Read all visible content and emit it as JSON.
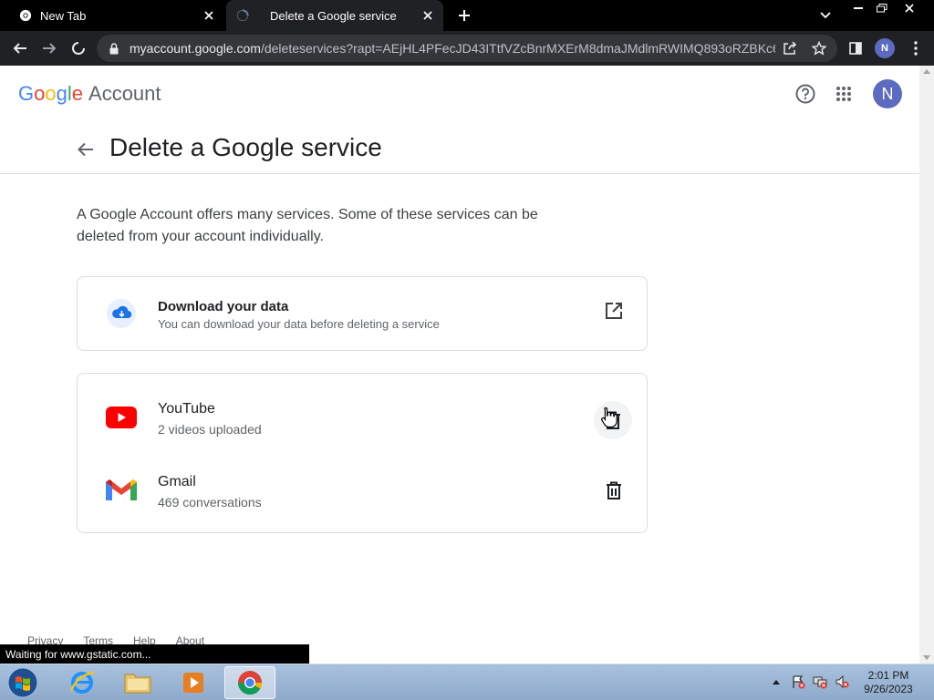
{
  "browser": {
    "tabs": [
      {
        "title": "New Tab",
        "icon": "chrome-icon"
      },
      {
        "title": "Delete a Google service",
        "icon": "loading-spinner-icon"
      }
    ],
    "url_host": "myaccount.google.com",
    "url_path": "/deleteservices?rapt=AEjHL4PFecJD43ITtfVZcBnrMXErM8dmaJMdlmRWIMQ893oRZBKc6...",
    "profile_initial": "N",
    "status_text": "Waiting for www.gstatic.com..."
  },
  "header": {
    "logo_letters": [
      "G",
      "o",
      "o",
      "g",
      "l",
      "e"
    ],
    "logo_colors": [
      "#4285F4",
      "#EA4335",
      "#FBBC05",
      "#4285F4",
      "#34A853",
      "#EA4335"
    ],
    "product": "Account",
    "avatar_initial": "N"
  },
  "page": {
    "title": "Delete a Google service",
    "intro": "A Google Account offers many services. Some of these services can be deleted from your account individually."
  },
  "download": {
    "title": "Download your data",
    "subtitle": "You can download your data before deleting a service"
  },
  "services": [
    {
      "name": "YouTube",
      "detail": "2 videos uploaded",
      "icon": "youtube-icon"
    },
    {
      "name": "Gmail",
      "detail": "469 conversations",
      "icon": "gmail-icon"
    }
  ],
  "footer": {
    "links": [
      "Privacy",
      "Terms",
      "Help",
      "About"
    ]
  },
  "taskbar": {
    "time": "2:01 PM",
    "date": "9/26/2023"
  },
  "colors": {
    "accent": "#1a73e8",
    "avatar": "#5c6bc0",
    "youtube_red": "#FF0000"
  }
}
